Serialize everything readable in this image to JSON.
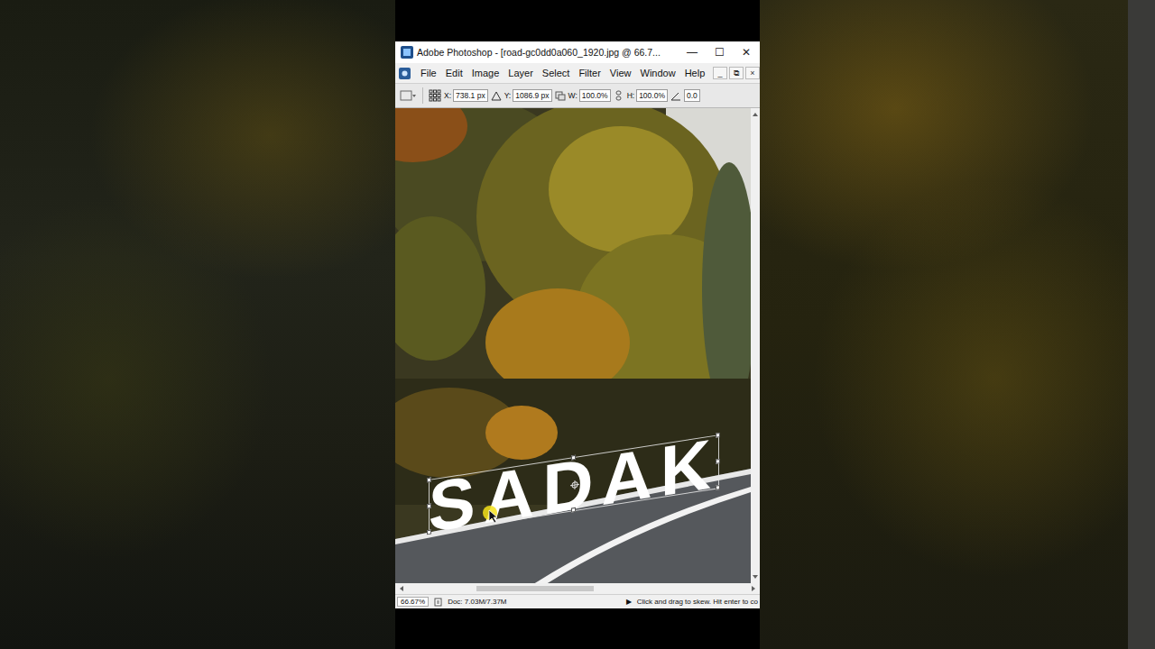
{
  "window": {
    "title": "Adobe Photoshop - [road-gc0dd0a060_1920.jpg @ 66.7...",
    "controls": [
      "—",
      "☐",
      "✕"
    ]
  },
  "menu": {
    "items": [
      "File",
      "Edit",
      "Image",
      "Layer",
      "Select",
      "Filter",
      "View",
      "Window",
      "Help"
    ],
    "doc_controls": [
      "_",
      "⧉",
      "×"
    ]
  },
  "options_bar": {
    "fields": [
      {
        "label": "X:",
        "value": "738.1 px"
      },
      {
        "label": "Y:",
        "value": "1086.9 px"
      },
      {
        "label": "W:",
        "value": "100.0%"
      },
      {
        "label": "H:",
        "value": "100.0%"
      },
      {
        "label": "",
        "value": "0.0"
      }
    ]
  },
  "canvas": {
    "text_layer": "SADAK"
  },
  "status_bar": {
    "zoom": "66.67%",
    "doc": "Doc: 7.03M/7.37M",
    "arrow": "▶",
    "message": "Click and drag to skew. Hit enter to co"
  }
}
